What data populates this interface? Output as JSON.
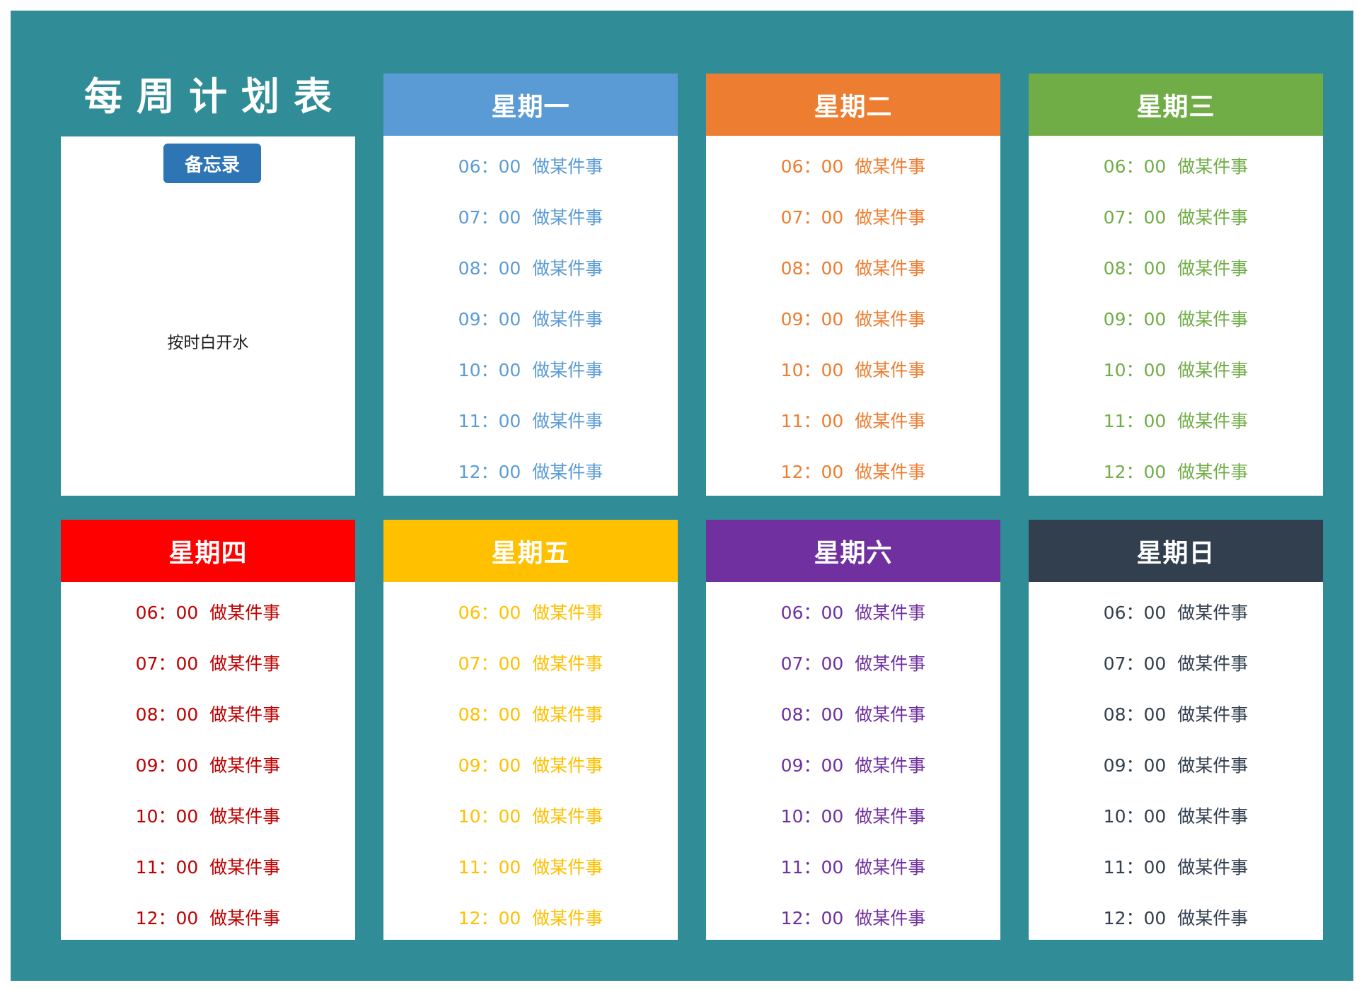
{
  "page": {
    "title": "每周计划表",
    "background_color": "#308c96"
  },
  "memo": {
    "button_label": "备忘录",
    "button_color": "#2e75b6",
    "note": "按时白开水"
  },
  "days": [
    {
      "name": "星期一",
      "color": "#5b9bd5",
      "slots": [
        {
          "time": "06：00",
          "task": "做某件事"
        },
        {
          "time": "07：00",
          "task": "做某件事"
        },
        {
          "time": "08：00",
          "task": "做某件事"
        },
        {
          "time": "09：00",
          "task": "做某件事"
        },
        {
          "time": "10：00",
          "task": "做某件事"
        },
        {
          "time": "11：00",
          "task": "做某件事"
        },
        {
          "time": "12：00",
          "task": "做某件事"
        }
      ]
    },
    {
      "name": "星期二",
      "color": "#ed7d31",
      "slots": [
        {
          "time": "06：00",
          "task": "做某件事"
        },
        {
          "time": "07：00",
          "task": "做某件事"
        },
        {
          "time": "08：00",
          "task": "做某件事"
        },
        {
          "time": "09：00",
          "task": "做某件事"
        },
        {
          "time": "10：00",
          "task": "做某件事"
        },
        {
          "time": "11：00",
          "task": "做某件事"
        },
        {
          "time": "12：00",
          "task": "做某件事"
        }
      ]
    },
    {
      "name": "星期三",
      "color": "#70ad47",
      "slots": [
        {
          "time": "06：00",
          "task": "做某件事"
        },
        {
          "time": "07：00",
          "task": "做某件事"
        },
        {
          "time": "08：00",
          "task": "做某件事"
        },
        {
          "time": "09：00",
          "task": "做某件事"
        },
        {
          "time": "10：00",
          "task": "做某件事"
        },
        {
          "time": "11：00",
          "task": "做某件事"
        },
        {
          "time": "12：00",
          "task": "做某件事"
        }
      ]
    },
    {
      "name": "星期四",
      "color": "#ff0000",
      "text_color": "#c00000",
      "slots": [
        {
          "time": "06：00",
          "task": "做某件事"
        },
        {
          "time": "07：00",
          "task": "做某件事"
        },
        {
          "time": "08：00",
          "task": "做某件事"
        },
        {
          "time": "09：00",
          "task": "做某件事"
        },
        {
          "time": "10：00",
          "task": "做某件事"
        },
        {
          "time": "11：00",
          "task": "做某件事"
        },
        {
          "time": "12：00",
          "task": "做某件事"
        }
      ]
    },
    {
      "name": "星期五",
      "color": "#ffc000",
      "slots": [
        {
          "time": "06：00",
          "task": "做某件事"
        },
        {
          "time": "07：00",
          "task": "做某件事"
        },
        {
          "time": "08：00",
          "task": "做某件事"
        },
        {
          "time": "09：00",
          "task": "做某件事"
        },
        {
          "time": "10：00",
          "task": "做某件事"
        },
        {
          "time": "11：00",
          "task": "做某件事"
        },
        {
          "time": "12：00",
          "task": "做某件事"
        }
      ]
    },
    {
      "name": "星期六",
      "color": "#7030a0",
      "slots": [
        {
          "time": "06：00",
          "task": "做某件事"
        },
        {
          "time": "07：00",
          "task": "做某件事"
        },
        {
          "time": "08：00",
          "task": "做某件事"
        },
        {
          "time": "09：00",
          "task": "做某件事"
        },
        {
          "time": "10：00",
          "task": "做某件事"
        },
        {
          "time": "11：00",
          "task": "做某件事"
        },
        {
          "time": "12：00",
          "task": "做某件事"
        }
      ]
    },
    {
      "name": "星期日",
      "color": "#323f4f",
      "slots": [
        {
          "time": "06：00",
          "task": "做某件事"
        },
        {
          "time": "07：00",
          "task": "做某件事"
        },
        {
          "time": "08：00",
          "task": "做某件事"
        },
        {
          "time": "09：00",
          "task": "做某件事"
        },
        {
          "time": "10：00",
          "task": "做某件事"
        },
        {
          "time": "11：00",
          "task": "做某件事"
        },
        {
          "time": "12：00",
          "task": "做某件事"
        }
      ]
    }
  ]
}
